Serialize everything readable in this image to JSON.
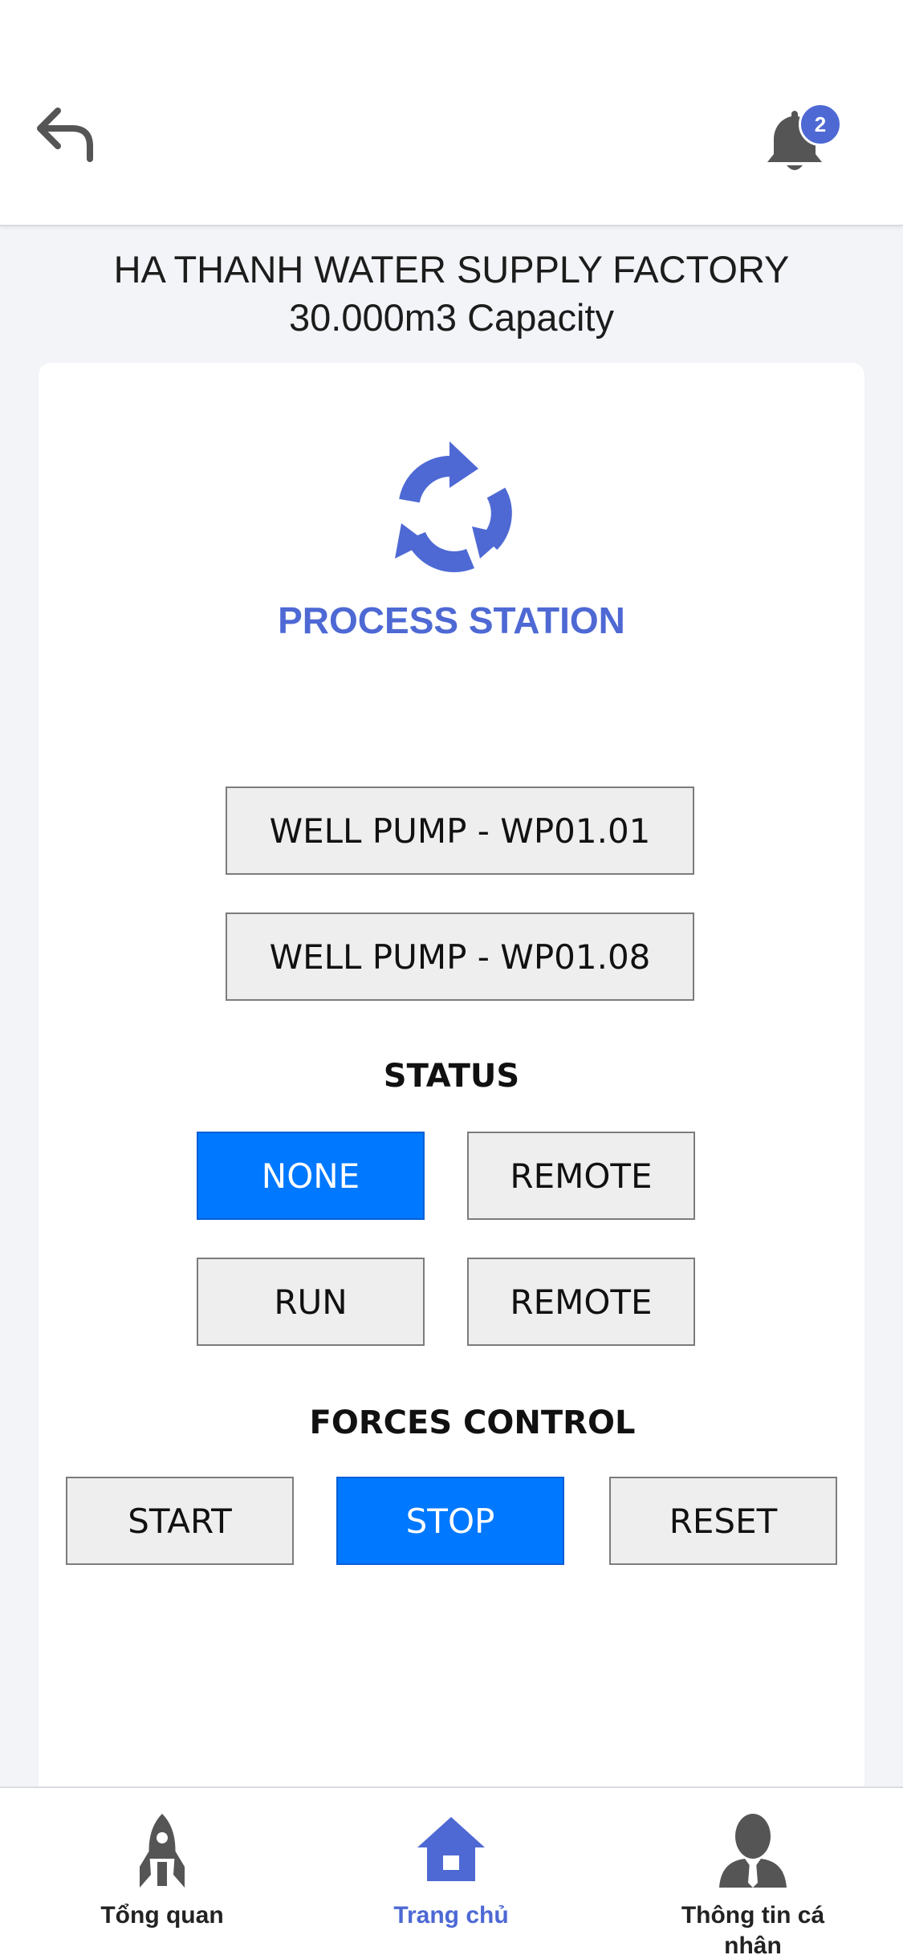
{
  "header": {
    "back_icon": "back-arrow-icon",
    "bell_icon": "bell-icon",
    "notification_count": "2"
  },
  "factory": {
    "name": "HA THANH WATER SUPPLY FACTORY",
    "capacity": "30.000m3 Capacity"
  },
  "station": {
    "icon": "refresh-cycle-icon",
    "title": "PROCESS STATION",
    "accent_color": "#4e69d4"
  },
  "pumps": [
    {
      "label": "WELL PUMP - WP01.01"
    },
    {
      "label": "WELL PUMP - WP01.08"
    }
  ],
  "status": {
    "title": "STATUS",
    "buttons": [
      {
        "label": "NONE",
        "active": true
      },
      {
        "label": "REMOTE",
        "active": false
      },
      {
        "label": "RUN",
        "active": false
      },
      {
        "label": "REMOTE",
        "active": false
      }
    ]
  },
  "forces_control": {
    "title": "FORCES CONTROL",
    "buttons": [
      {
        "label": "START",
        "active": false
      },
      {
        "label": "STOP",
        "active": true
      },
      {
        "label": "RESET",
        "active": false
      }
    ]
  },
  "active_button_color": "#0078ff",
  "tabbar": {
    "tabs": [
      {
        "label": "Tổng quan",
        "icon": "rocket-icon",
        "active": false
      },
      {
        "label": "Trang chủ",
        "icon": "home-icon",
        "active": true
      },
      {
        "label": "Thông tin cá nhân",
        "icon": "user-icon",
        "active": false
      }
    ]
  }
}
